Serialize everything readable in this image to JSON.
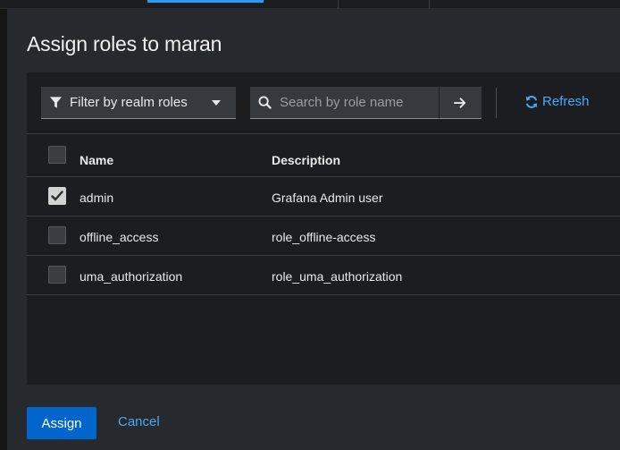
{
  "modal": {
    "title": "Assign roles to maran"
  },
  "toolbar": {
    "filter_label": "Filter by realm roles",
    "filter_icon": "filter-icon",
    "search_placeholder": "Search by role name",
    "search_value": "",
    "refresh_label": "Refresh"
  },
  "table": {
    "columns": [
      "Name",
      "Description"
    ],
    "rows": [
      {
        "name": "admin",
        "description": "Grafana Admin user",
        "checked": true
      },
      {
        "name": "offline_access",
        "description": "role_offline-access",
        "checked": false
      },
      {
        "name": "uma_authorization",
        "description": "role_uma_authorization",
        "checked": false
      }
    ]
  },
  "footer": {
    "assign_label": "Assign",
    "cancel_label": "Cancel"
  },
  "colors": {
    "primary": "#0066cc",
    "link": "#4aa8f5",
    "modal_bg": "#26292d",
    "panel_bg": "#1b1d21"
  }
}
